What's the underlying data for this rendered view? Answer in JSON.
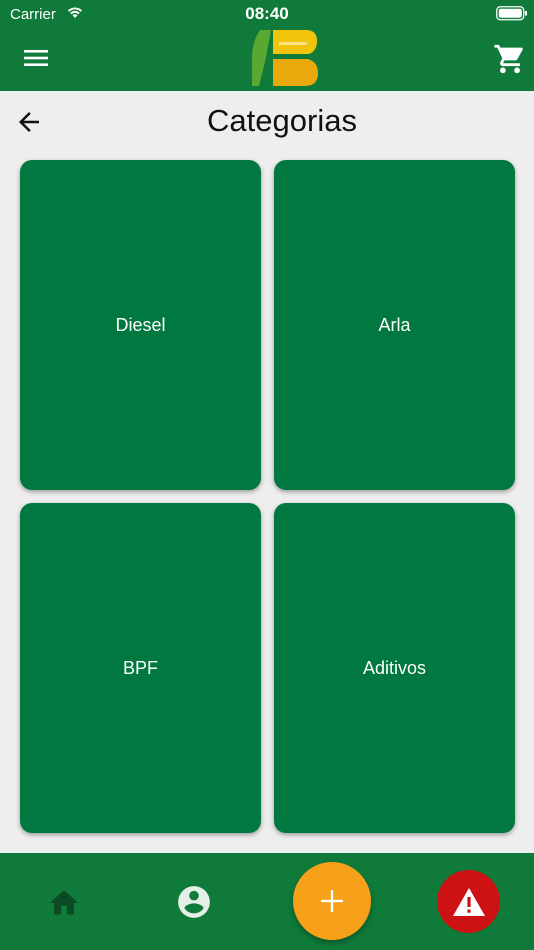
{
  "status_bar": {
    "carrier": "Carrier",
    "time": "08:40"
  },
  "header": {
    "menu_icon": "menu-icon",
    "logo": "brand-logo",
    "cart_icon": "cart-icon"
  },
  "page": {
    "title": "Categorias",
    "back_icon": "arrow-left-icon"
  },
  "categories": [
    {
      "label": "Diesel"
    },
    {
      "label": "Arla"
    },
    {
      "label": "BPF"
    },
    {
      "label": "Aditivos"
    }
  ],
  "bottom_nav": {
    "home_icon": "home-icon",
    "profile_icon": "account-circle-icon",
    "add_icon": "plus-icon",
    "alert_icon": "warning-icon"
  },
  "colors": {
    "primary_green": "#0f7a3a",
    "card_green": "#007840",
    "dark_green_icon": "#0a4a25",
    "fab_orange": "#f7a01a",
    "alert_red": "#cc1212",
    "background": "#eeeeee",
    "logo_yellow": "#f2c40c",
    "logo_green": "#5aa832"
  }
}
